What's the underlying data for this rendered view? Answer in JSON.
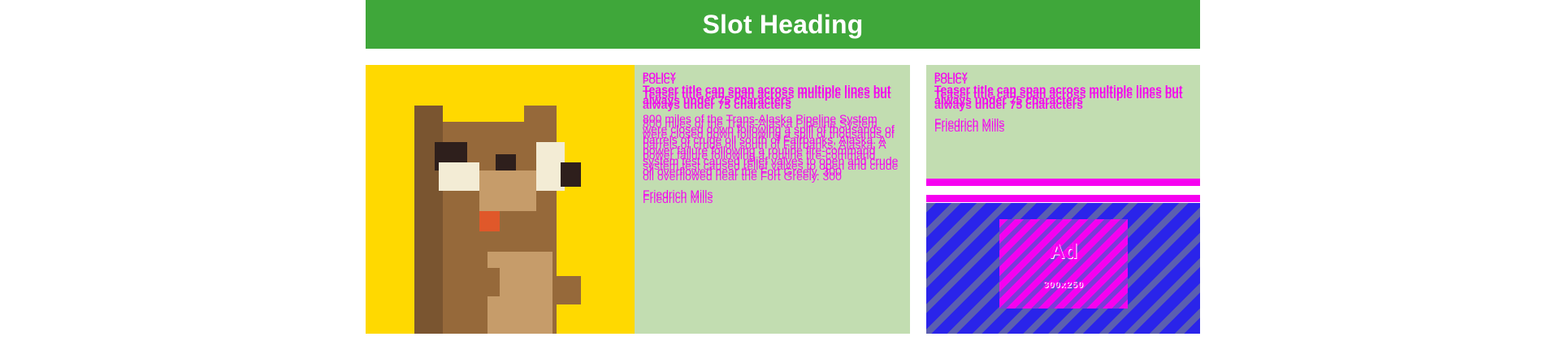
{
  "slot": {
    "heading": "Slot Heading",
    "header_color": "#3fa73a"
  },
  "teaser_large": {
    "kicker": "POLICY",
    "title": "Teaser title can span across multiple lines but always under 75 characters",
    "body": "800 miles of the Trans-Alaska Pipeline System were closed down following a spill of thousands of barrels of crude oil south of Fairbanks, Alaska. A power failure following a routine fire-command system test caused relief valves to open and crude oil overflowed near the Fort Greely. 300",
    "byline": "Friedrich Mills",
    "image_icon": "squirrel-illustration"
  },
  "teaser_small": {
    "kicker": "POLICY",
    "title": "Teaser title can span across multiple lines but always under 75 characters",
    "byline": "Friedrich Mills"
  },
  "ad": {
    "label": "Ad",
    "size": "300x250"
  },
  "colors": {
    "text_debug": "#f600f0",
    "card_bg": "#c2ddb1",
    "image_bg": "#ffd900"
  }
}
